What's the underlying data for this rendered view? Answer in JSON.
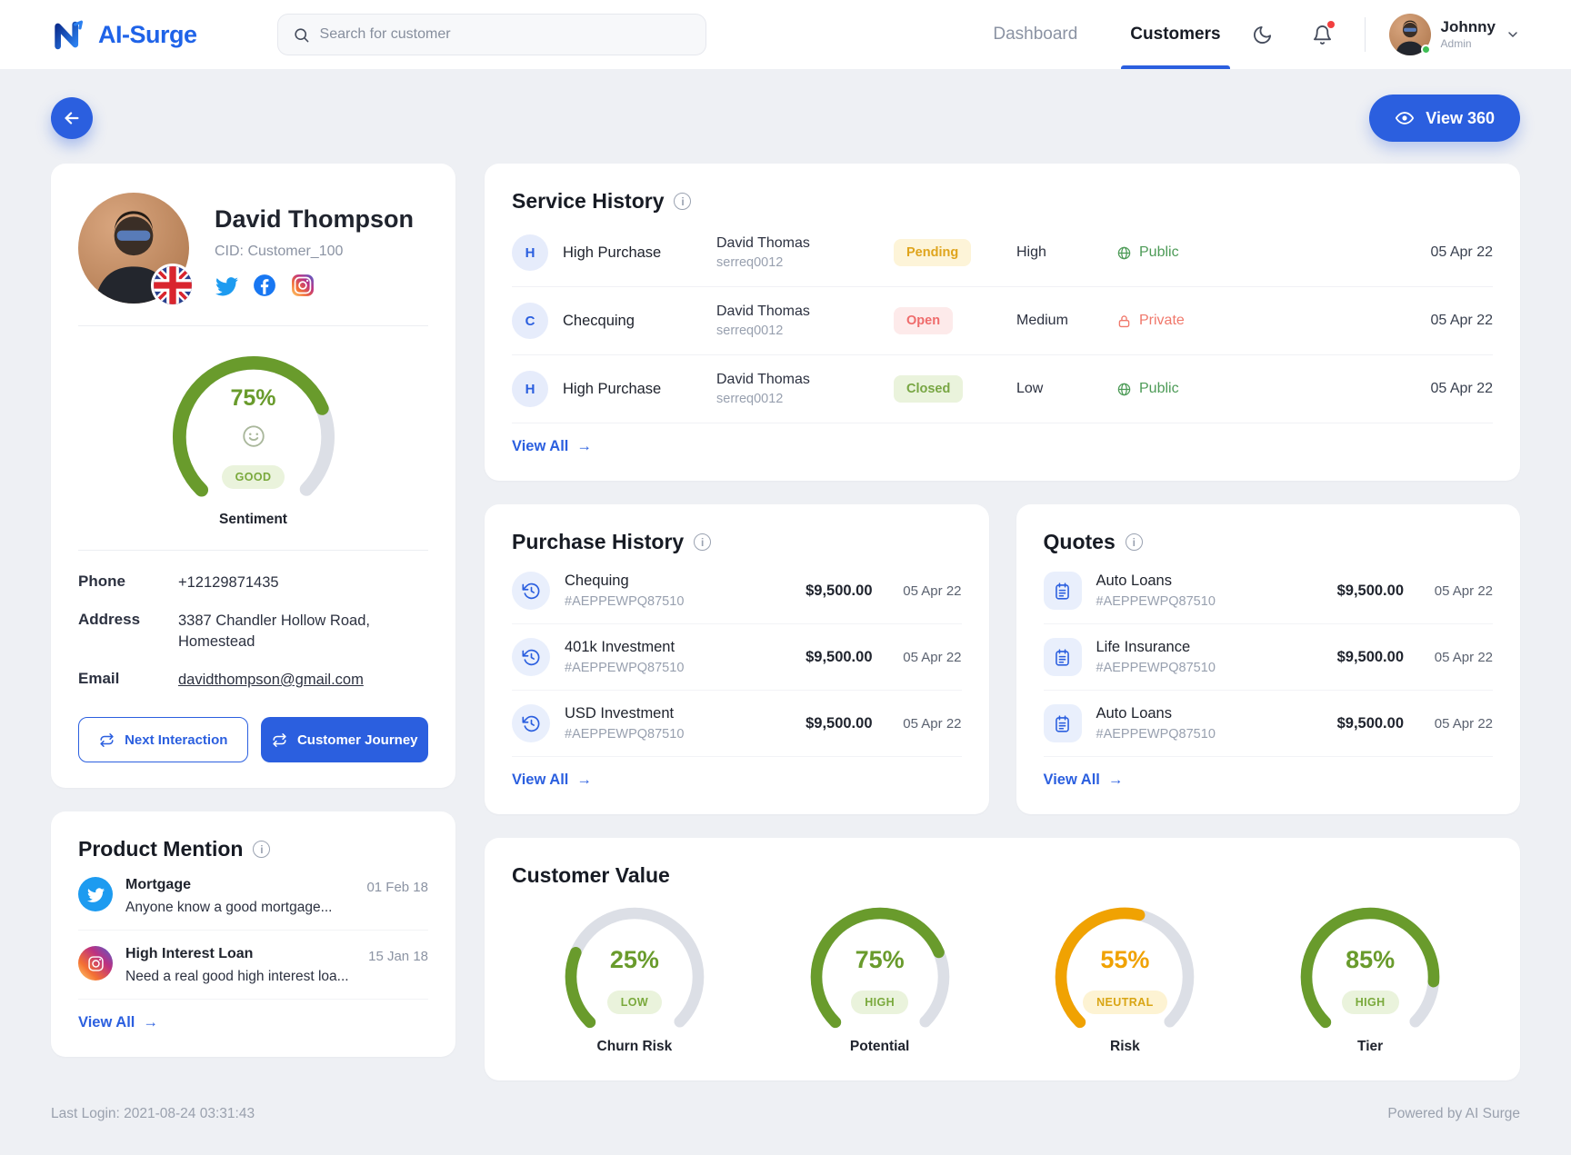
{
  "colors": {
    "accent": "#2b5fdf",
    "green": "#699b2c",
    "amber": "#f0a202"
  },
  "header": {
    "brand": "AI-Surge",
    "search_placeholder": "Search for customer",
    "nav": [
      {
        "label": "Dashboard"
      },
      {
        "label": "Customers"
      }
    ],
    "user": {
      "name": "Johnny",
      "role": "Admin"
    }
  },
  "toolbar": {
    "view360": "View 360"
  },
  "profile": {
    "name": "David Thompson",
    "cid": "CID: Customer_100",
    "sentiment": {
      "value": 75,
      "label": "75%",
      "rating": "GOOD",
      "caption": "Sentiment",
      "color": "#699b2c"
    },
    "contact": {
      "phone_label": "Phone",
      "phone": "+12129871435",
      "address_label": "Address",
      "address": "3387 Chandler Hollow Road, Homestead",
      "email_label": "Email",
      "email": "davidthompson@gmail.com"
    },
    "actions": {
      "next_interaction": "Next Interaction",
      "customer_journey": "Customer Journey"
    }
  },
  "service_history": {
    "title": "Service History",
    "view_all": "View All",
    "rows": [
      {
        "initial": "H",
        "service": "High Purchase",
        "agent": "David Thomas",
        "ref": "serreq0012",
        "status": "Pending",
        "priority": "High",
        "visibility": "Public",
        "date": "05 Apr 22"
      },
      {
        "initial": "C",
        "service": "Checquing",
        "agent": "David Thomas",
        "ref": "serreq0012",
        "status": "Open",
        "priority": "Medium",
        "visibility": "Private",
        "date": "05 Apr 22"
      },
      {
        "initial": "H",
        "service": "High Purchase",
        "agent": "David Thomas",
        "ref": "serreq0012",
        "status": "Closed",
        "priority": "Low",
        "visibility": "Public",
        "date": "05 Apr 22"
      }
    ]
  },
  "purchase_history": {
    "title": "Purchase History",
    "view_all": "View All",
    "rows": [
      {
        "name": "Chequing",
        "ref": "#AEPPEWPQ87510",
        "amount": "$9,500.00",
        "date": "05 Apr 22"
      },
      {
        "name": "401k Investment",
        "ref": "#AEPPEWPQ87510",
        "amount": "$9,500.00",
        "date": "05 Apr 22"
      },
      {
        "name": "USD Investment",
        "ref": "#AEPPEWPQ87510",
        "amount": "$9,500.00",
        "date": "05 Apr 22"
      }
    ]
  },
  "quotes": {
    "title": "Quotes",
    "view_all": "View All",
    "rows": [
      {
        "name": "Auto Loans",
        "ref": "#AEPPEWPQ87510",
        "amount": "$9,500.00",
        "date": "05 Apr 22"
      },
      {
        "name": "Life Insurance",
        "ref": "#AEPPEWPQ87510",
        "amount": "$9,500.00",
        "date": "05 Apr 22"
      },
      {
        "name": "Auto Loans",
        "ref": "#AEPPEWPQ87510",
        "amount": "$9,500.00",
        "date": "05 Apr 22"
      }
    ]
  },
  "product_mention": {
    "title": "Product Mention",
    "view_all": "View All",
    "items": [
      {
        "source": "twitter",
        "name": "Mortgage",
        "snippet": "Anyone know a good mortgage...",
        "date": "01 Feb 18"
      },
      {
        "source": "instagram",
        "name": "High Interest Loan",
        "snippet": "Need a real good high interest loa...",
        "date": "15 Jan 18"
      }
    ]
  },
  "customer_value": {
    "title": "Customer Value",
    "gauges": [
      {
        "value": 25,
        "label": "25%",
        "rating": "LOW",
        "caption": "Churn Risk",
        "color": "#699b2c",
        "tone": "green"
      },
      {
        "value": 75,
        "label": "75%",
        "rating": "HIGH",
        "caption": "Potential",
        "color": "#699b2c",
        "tone": "green"
      },
      {
        "value": 55,
        "label": "55%",
        "rating": "NEUTRAL",
        "caption": "Risk",
        "color": "#f0a202",
        "tone": "amber"
      },
      {
        "value": 85,
        "label": "85%",
        "rating": "HIGH",
        "caption": "Tier",
        "color": "#699b2c",
        "tone": "green"
      }
    ]
  },
  "footer": {
    "last_login": "Last  Login: 2021-08-24 03:31:43",
    "powered_by": "Powered by AI Surge"
  }
}
